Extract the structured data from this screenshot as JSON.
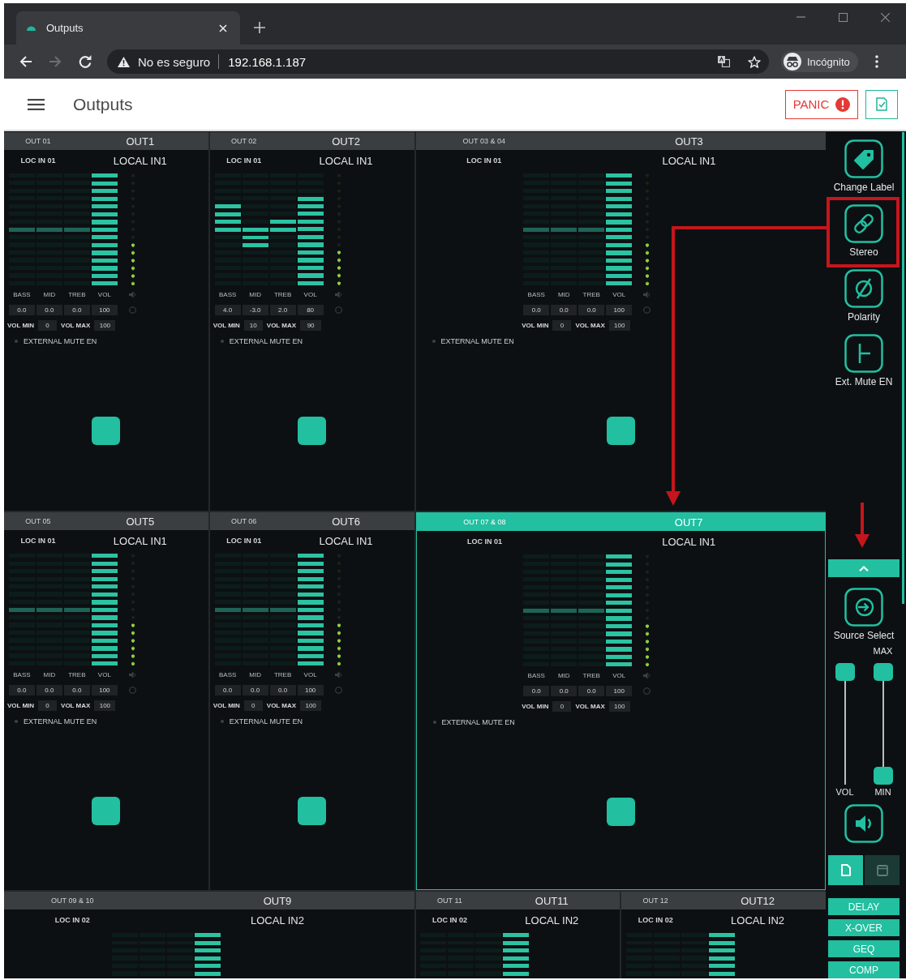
{
  "browser": {
    "tab": {
      "title": "Outputs"
    },
    "forward_button": {
      "disabled": true
    },
    "address_bar": {
      "security": "No es seguro",
      "url": "192.168.1.187"
    },
    "profile": {
      "label": "Incógnito"
    }
  },
  "app_header": {
    "title": "Outputs",
    "panic_button": {
      "label": "PANIC"
    }
  },
  "tiles": [
    {
      "kind": "mono",
      "selected": false,
      "channel": "OUT 01",
      "name": "OUT1",
      "source_code": "LOC IN 01",
      "source": "LOCAL IN1",
      "controls": [
        {
          "kind": "gain",
          "label": "BASS",
          "value": "0.0",
          "level": 0.5
        },
        {
          "kind": "gain",
          "label": "MID",
          "value": "0.0",
          "level": 0.5
        },
        {
          "kind": "gain",
          "label": "TREB",
          "value": "0.0",
          "level": 0.5
        },
        {
          "kind": "volume",
          "label": "VOL",
          "value": "100",
          "level": 1
        }
      ],
      "meter": {
        "level": 0.4
      },
      "vol_min": {
        "label": "VOL MIN",
        "value": "0"
      },
      "vol_max": {
        "label": "VOL MAX",
        "value": "100"
      },
      "external_mute": {
        "label": "EXTERNAL MUTE EN",
        "on": false
      }
    },
    {
      "kind": "mono",
      "selected": false,
      "channel": "OUT 02",
      "name": "OUT2",
      "source_code": "LOC IN 01",
      "source": "LOCAL IN1",
      "controls": [
        {
          "kind": "gain",
          "label": "BASS",
          "value": "4.0",
          "level": 0.714
        },
        {
          "kind": "gain",
          "label": "MID",
          "value": "-3.0",
          "level": 0.357
        },
        {
          "kind": "gain",
          "label": "TREB",
          "value": "2.0",
          "level": 0.571
        },
        {
          "kind": "volume",
          "label": "VOL",
          "value": "80",
          "level": 0.8
        }
      ],
      "meter": {
        "level": 0.333
      },
      "vol_min": {
        "label": "VOL MIN",
        "value": "10"
      },
      "vol_max": {
        "label": "VOL MAX",
        "value": "90"
      },
      "external_mute": {
        "label": "EXTERNAL MUTE EN",
        "on": false
      }
    },
    {
      "kind": "stereo",
      "selected": false,
      "channel": "OUT 03 & 04",
      "name": "OUT3",
      "source_code": "LOC IN 01",
      "source": "LOCAL IN1",
      "controls": [
        {
          "kind": "gain",
          "label": "BASS",
          "value": "0.0",
          "level": 0.5
        },
        {
          "kind": "gain",
          "label": "MID",
          "value": "0.0",
          "level": 0.5
        },
        {
          "kind": "gain",
          "label": "TREB",
          "value": "0.0",
          "level": 0.5
        },
        {
          "kind": "volume",
          "label": "VOL",
          "value": "100",
          "level": 1
        }
      ],
      "meter": {
        "level": 0.4
      },
      "vol_min": {
        "label": "VOL MIN",
        "value": "0"
      },
      "vol_max": {
        "label": "VOL MAX",
        "value": "100"
      },
      "external_mute": {
        "label": "EXTERNAL MUTE EN",
        "on": false
      }
    },
    {
      "kind": "mono",
      "selected": false,
      "channel": "OUT 05",
      "name": "OUT5",
      "source_code": "LOC IN 01",
      "source": "LOCAL IN1",
      "controls": [
        {
          "kind": "gain",
          "label": "BASS",
          "value": "0.0",
          "level": 0.5
        },
        {
          "kind": "gain",
          "label": "MID",
          "value": "0.0",
          "level": 0.5
        },
        {
          "kind": "gain",
          "label": "TREB",
          "value": "0.0",
          "level": 0.5
        },
        {
          "kind": "volume",
          "label": "VOL",
          "value": "100",
          "level": 1
        }
      ],
      "meter": {
        "level": 0.4
      },
      "vol_min": {
        "label": "VOL MIN",
        "value": "0"
      },
      "vol_max": {
        "label": "VOL MAX",
        "value": "100"
      },
      "external_mute": {
        "label": "EXTERNAL MUTE EN",
        "on": false
      }
    },
    {
      "kind": "mono",
      "selected": false,
      "channel": "OUT 06",
      "name": "OUT6",
      "source_code": "LOC IN 01",
      "source": "LOCAL IN1",
      "controls": [
        {
          "kind": "gain",
          "label": "BASS",
          "value": "0.0",
          "level": 0.5
        },
        {
          "kind": "gain",
          "label": "MID",
          "value": "0.0",
          "level": 0.5
        },
        {
          "kind": "gain",
          "label": "TREB",
          "value": "0.0",
          "level": 0.5
        },
        {
          "kind": "volume",
          "label": "VOL",
          "value": "100",
          "level": 1
        }
      ],
      "meter": {
        "level": 0.4
      },
      "vol_min": {
        "label": "VOL MIN",
        "value": "0"
      },
      "vol_max": {
        "label": "VOL MAX",
        "value": "100"
      },
      "external_mute": {
        "label": "EXTERNAL MUTE EN",
        "on": false
      }
    },
    {
      "kind": "stereo",
      "selected": true,
      "channel": "OUT 07 & 08",
      "name": "OUT7",
      "source_code": "LOC IN 01",
      "source": "LOCAL IN1",
      "controls": [
        {
          "kind": "gain",
          "label": "BASS",
          "value": "0.0",
          "level": 0.5
        },
        {
          "kind": "gain",
          "label": "MID",
          "value": "0.0",
          "level": 0.5
        },
        {
          "kind": "gain",
          "label": "TREB",
          "value": "0.0",
          "level": 0.5
        },
        {
          "kind": "volume",
          "label": "VOL",
          "value": "100",
          "level": 1
        }
      ],
      "meter": {
        "level": 0.4
      },
      "vol_min": {
        "label": "VOL MIN",
        "value": "0"
      },
      "vol_max": {
        "label": "VOL MAX",
        "value": "100"
      },
      "external_mute": {
        "label": "EXTERNAL MUTE EN",
        "on": false
      }
    },
    {
      "kind": "stereo",
      "selected": false,
      "channel": "OUT 09 & 10",
      "name": "OUT9",
      "source_code": "LOC IN 02",
      "source": "LOCAL IN2",
      "controls": [
        {
          "kind": "gain"
        },
        {
          "kind": "gain"
        },
        {
          "kind": "gain"
        },
        {
          "kind": "volume",
          "level": 1
        }
      ]
    },
    {
      "kind": "mono",
      "selected": false,
      "channel": "OUT 11",
      "name": "OUT11",
      "source_code": "LOC IN 02",
      "source": "LOCAL IN2",
      "controls": [
        {
          "kind": "gain"
        },
        {
          "kind": "gain"
        },
        {
          "kind": "gain"
        },
        {
          "kind": "volume",
          "level": 1
        }
      ]
    },
    {
      "kind": "mono",
      "selected": false,
      "channel": "OUT 12",
      "name": "OUT12",
      "source_code": "LOC IN 02",
      "source": "LOCAL IN2",
      "controls": [
        {
          "kind": "gain"
        },
        {
          "kind": "gain"
        },
        {
          "kind": "gain"
        },
        {
          "kind": "volume",
          "level": 1
        }
      ]
    }
  ],
  "sidebar": {
    "actions": [
      {
        "kind": "label",
        "label": "Change Label"
      },
      {
        "kind": "stereo",
        "label": "Stereo"
      },
      {
        "kind": "polarity",
        "label": "Polarity"
      },
      {
        "kind": "mute",
        "label": "Ext. Mute EN"
      }
    ],
    "source_select": {
      "label": "Source Select"
    },
    "volume_slider": {
      "label": "VOL",
      "level": 1
    },
    "range_slider": {
      "upper": {
        "label": "MAX",
        "level": 1
      },
      "lower": {
        "label": "MIN",
        "level": 0
      }
    },
    "view_toggles": [
      {
        "selected": true
      },
      {
        "selected": false
      }
    ],
    "function_buttons": [
      {
        "label": "DELAY"
      },
      {
        "label": "X-OVER"
      },
      {
        "label": "GEQ"
      },
      {
        "label": "COMP"
      }
    ]
  }
}
